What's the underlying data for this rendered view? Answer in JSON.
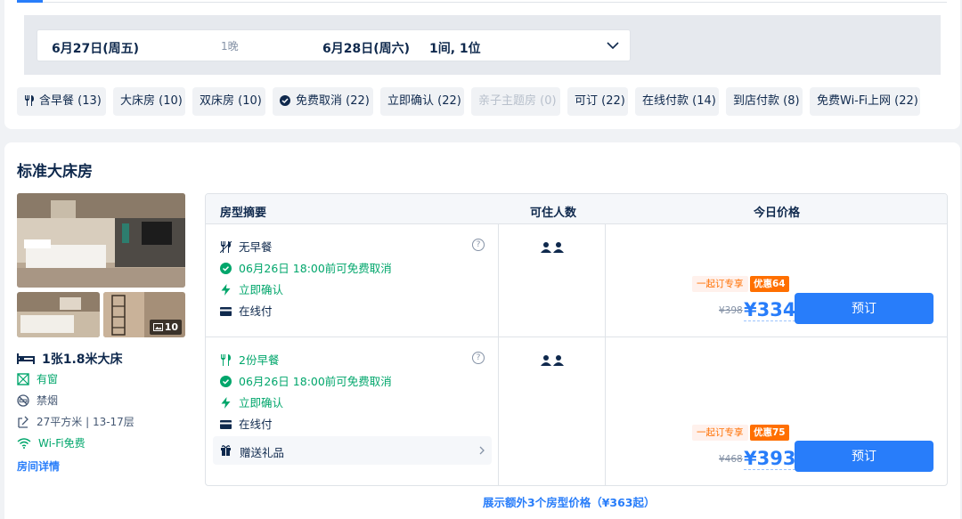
{
  "search": {
    "checkin": "6月27日(周五)",
    "nights": "1晚",
    "checkout": "6月28日(周六)",
    "guests": "1间, 1位"
  },
  "filters": [
    {
      "label": "含早餐 (13)",
      "icon": "fork-knife-icon"
    },
    {
      "label": "大床房 (10)"
    },
    {
      "label": "双床房 (10)"
    },
    {
      "label": "免费取消 (22)",
      "icon": "check-circle-icon"
    },
    {
      "label": "立即确认 (22)"
    },
    {
      "label": "亲子主题房 (0)",
      "disabled": true
    },
    {
      "label": "可订 (22)"
    },
    {
      "label": "在线付款 (14)"
    },
    {
      "label": "到店付款 (8)"
    },
    {
      "label": "免费Wi-Fi上网 (22)"
    }
  ],
  "room": {
    "title": "标准大床房",
    "photo_count": "10",
    "features": {
      "bed": "1张1.8米大床",
      "window": "有窗",
      "smoking": "禁烟",
      "area": "27平方米 | 13-17层",
      "wifi": "Wi-Fi免费"
    },
    "detail_link": "房间详情"
  },
  "table": {
    "headers": {
      "summary": "房型摘要",
      "capacity": "可住人数",
      "price": "今日价格"
    },
    "rows": [
      {
        "meal": "无早餐",
        "cancel": "06月26日 18:00前可免费取消",
        "confirm": "立即确认",
        "payment": "在线付",
        "promo_tag": "一起订专享",
        "discount_tag": "优惠64",
        "old_price": "¥398",
        "price": "¥334",
        "book_label": "预订"
      },
      {
        "meal": "2份早餐",
        "cancel": "06月26日 18:00前可免费取消",
        "confirm": "立即确认",
        "payment": "在线付",
        "gift": "赠送礼品",
        "promo_tag": "一起订专享",
        "discount_tag": "优惠75",
        "old_price": "¥468",
        "price": "¥393",
        "book_label": "预订"
      }
    ]
  },
  "more_link": "展示额外3个房型价格（¥363起）",
  "colors": {
    "primary": "#287dfa",
    "green": "#00a66b",
    "orange": "#ff6f00",
    "text": "#0f294d"
  }
}
